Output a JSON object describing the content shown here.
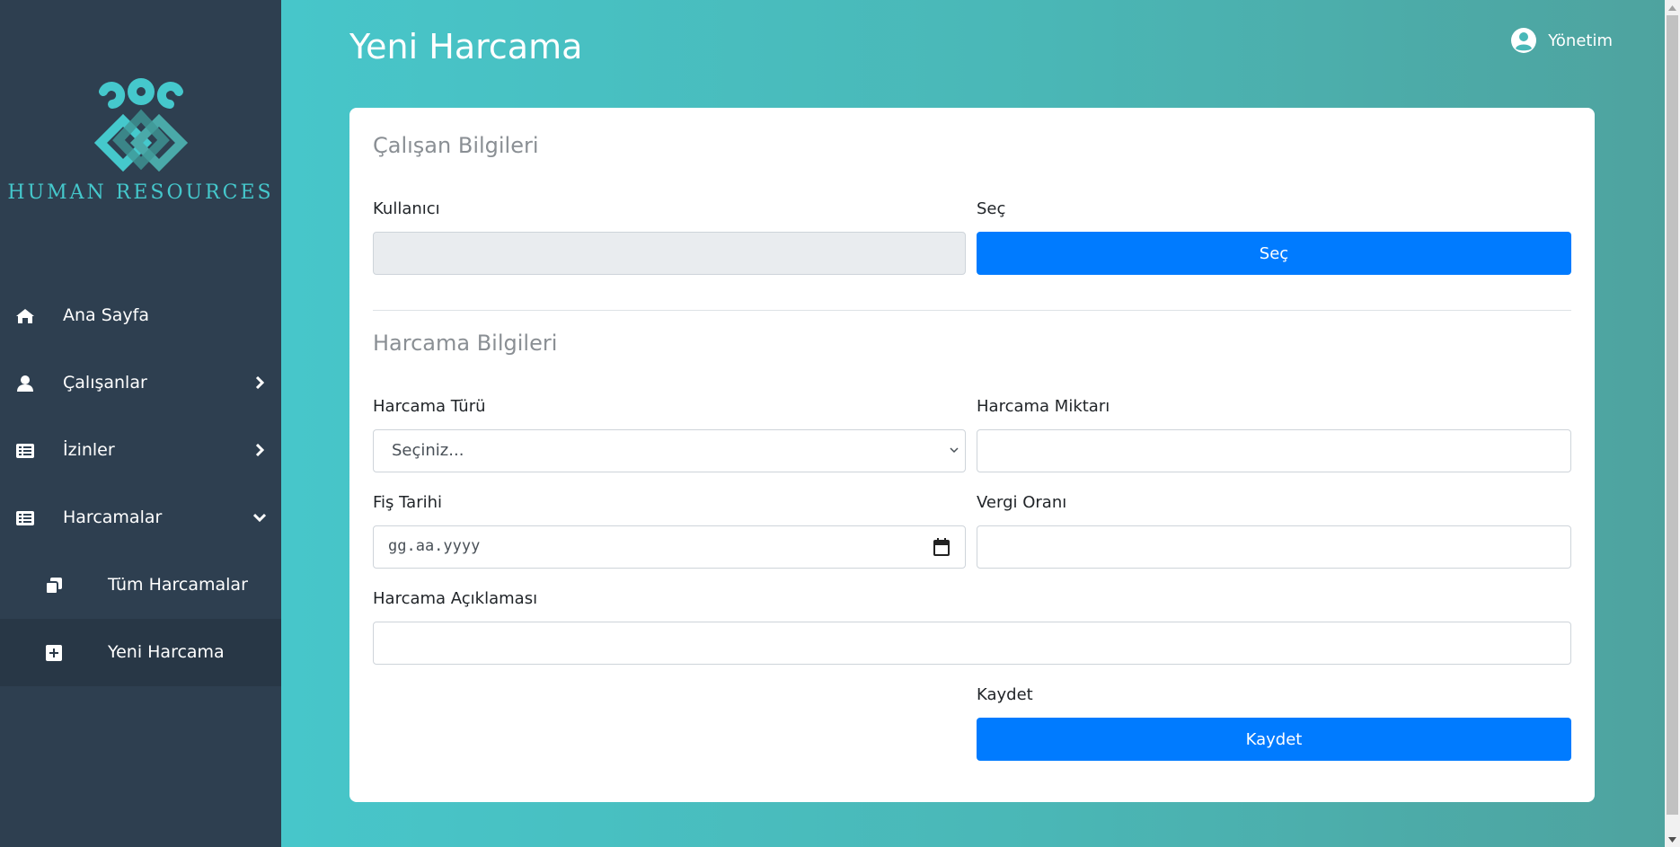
{
  "brand": {
    "logo_text": "HUMAN RESOURCES"
  },
  "sidebar": {
    "items": [
      {
        "label": "Ana Sayfa",
        "icon": "home-icon"
      },
      {
        "label": "Çalışanlar",
        "icon": "user-icon",
        "chevron": "chevron-right-icon"
      },
      {
        "label": "İzinler",
        "icon": "list-icon",
        "chevron": "chevron-right-icon"
      },
      {
        "label": "Harcamalar",
        "icon": "list-icon",
        "chevron": "chevron-down-icon"
      },
      {
        "label": "Tüm Harcamalar",
        "icon": "copy-icon"
      },
      {
        "label": "Yeni Harcama",
        "icon": "plus-square-icon",
        "active": true
      }
    ]
  },
  "header": {
    "title": "Yeni Harcama",
    "user_label": "Yönetim"
  },
  "form": {
    "employee_section_title": "Çalışan Bilgileri",
    "user_label": "Kullanıcı",
    "user_value": "",
    "select_label": "Seç",
    "select_button": "Seç",
    "expense_section_title": "Harcama Bilgileri",
    "type_label": "Harcama Türü",
    "type_selected": "Seçiniz...",
    "amount_label": "Harcama Miktarı",
    "amount_value": "",
    "date_label": "Fiş Tarihi",
    "date_placeholder": "gg.aa.yyyy",
    "tax_label": "Vergi Oranı",
    "tax_value": "",
    "description_label": "Harcama Açıklaması",
    "description_value": "",
    "save_label": "Kaydet",
    "save_button": "Kaydet"
  },
  "colors": {
    "sidebar_bg": "#2e3f50",
    "accent_teal": "#47c6ca",
    "primary_button": "#007bff"
  }
}
